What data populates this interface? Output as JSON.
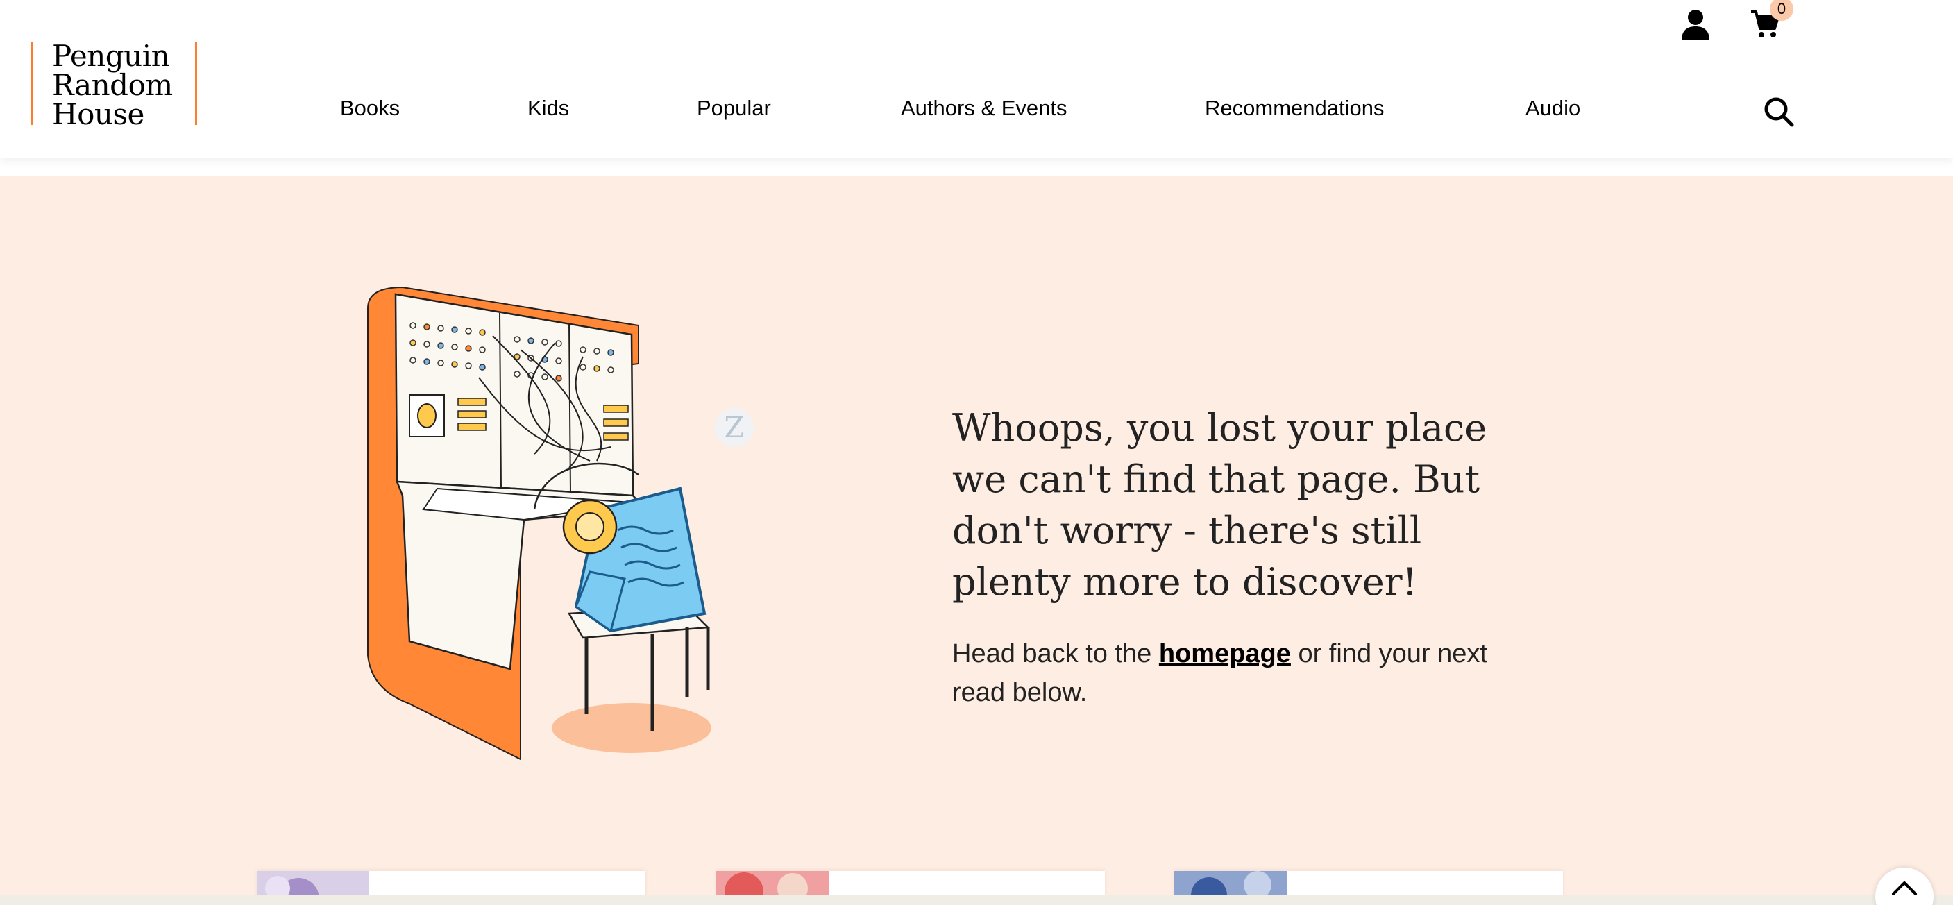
{
  "brand": {
    "logo_lines": [
      "Penguin",
      "Random",
      "House"
    ],
    "accent_color": "#ff7c30"
  },
  "utility": {
    "account_icon": "person-icon",
    "cart_icon": "cart-icon",
    "cart_count": "0"
  },
  "nav": {
    "items": [
      {
        "label": "Books"
      },
      {
        "label": "Kids"
      },
      {
        "label": "Popular"
      },
      {
        "label": "Authors & Events"
      },
      {
        "label": "Recommendations"
      },
      {
        "label": "Audio"
      }
    ],
    "search_icon": "search-icon"
  },
  "error": {
    "headline": "Whoops, you lost your place we can't find that page. But don't worry - there's still plenty more to discover!",
    "sub_before": "Head back to the ",
    "homepage_link": "homepage",
    "sub_after": " or find your next read below.",
    "background_color": "#feede3"
  },
  "illustration": {
    "sleep_letter": "Z"
  },
  "scroll_top_icon": "chevron-up-icon"
}
